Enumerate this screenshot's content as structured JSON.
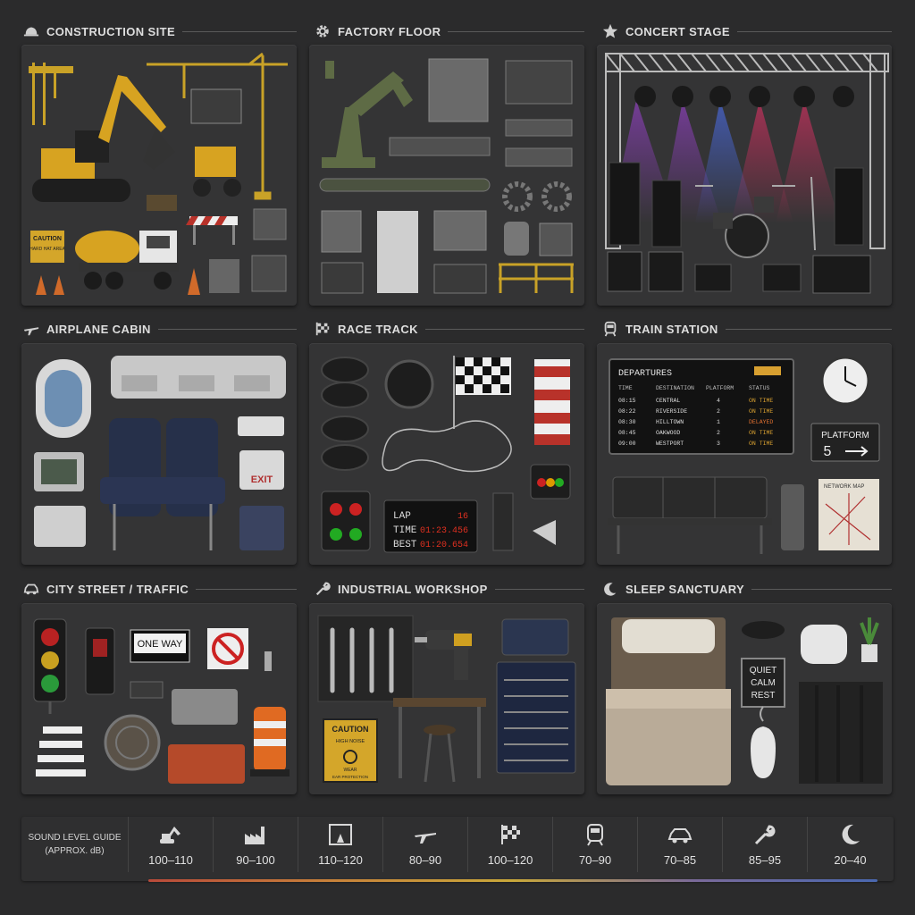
{
  "sections": {
    "construction": {
      "title": "CONSTRUCTION SITE",
      "sign_caution": "CAUTION",
      "sign_text": "HARD HAT AREA"
    },
    "factory": {
      "title": "FACTORY FLOOR"
    },
    "concert": {
      "title": "CONCERT STAGE"
    },
    "airplane": {
      "title": "AIRPLANE CABIN",
      "exit_label": "EXIT"
    },
    "race": {
      "title": "RACE TRACK",
      "lap_label": "LAP",
      "lap_value": "16",
      "time_label": "TIME",
      "time_value": "01:23.456",
      "best_label": "BEST",
      "best_value": "01:20.654"
    },
    "train": {
      "title": "TRAIN STATION",
      "board_title": "DEPARTURES",
      "columns": [
        "TIME",
        "DESTINATION",
        "PLATFORM",
        "STATUS"
      ],
      "rows": [
        [
          "08:15",
          "CENTRAL",
          "4",
          "ON TIME"
        ],
        [
          "08:22",
          "RIVERSIDE",
          "2",
          "ON TIME"
        ],
        [
          "08:30",
          "HILLTOWN",
          "1",
          "DELAYED"
        ],
        [
          "08:45",
          "OAKWOOD",
          "2",
          "ON TIME"
        ],
        [
          "09:00",
          "WESTPORT",
          "3",
          "ON TIME"
        ]
      ],
      "platform_label": "PLATFORM",
      "platform_number": "5",
      "map_title": "NETWORK MAP"
    },
    "street": {
      "title": "CITY STREET / TRAFFIC",
      "one_way": "ONE WAY"
    },
    "workshop": {
      "title": "INDUSTRIAL WORKSHOP",
      "caution": "CAUTION",
      "caution_line1": "HIGH NOISE",
      "caution_line2": "WEAR",
      "caution_line3": "EAR PROTECTION"
    },
    "sleep": {
      "title": "SLEEP SANCTUARY",
      "sign_lines": [
        "QUIET",
        "CALM",
        "REST"
      ]
    }
  },
  "legend": {
    "caption_line1": "SOUND LEVEL GUIDE",
    "caption_line2": "(APPROX. dB)",
    "items": [
      {
        "icon": "excavator-icon",
        "value": "100–110"
      },
      {
        "icon": "factory-icon",
        "value": "90–100"
      },
      {
        "icon": "stage-icon",
        "value": "110–120"
      },
      {
        "icon": "airplane-icon",
        "value": "80–90"
      },
      {
        "icon": "checkered-flag-icon",
        "value": "100–120"
      },
      {
        "icon": "train-icon",
        "value": "70–90"
      },
      {
        "icon": "car-icon",
        "value": "70–85"
      },
      {
        "icon": "wrench-icon",
        "value": "85–95"
      },
      {
        "icon": "moon-icon",
        "value": "20–40"
      }
    ]
  },
  "colors": {
    "background": "#2b2b2c",
    "panel": "#343435",
    "status_on_time": "#d8a030",
    "status_delayed": "#e07030",
    "race_red": "#e03020"
  }
}
